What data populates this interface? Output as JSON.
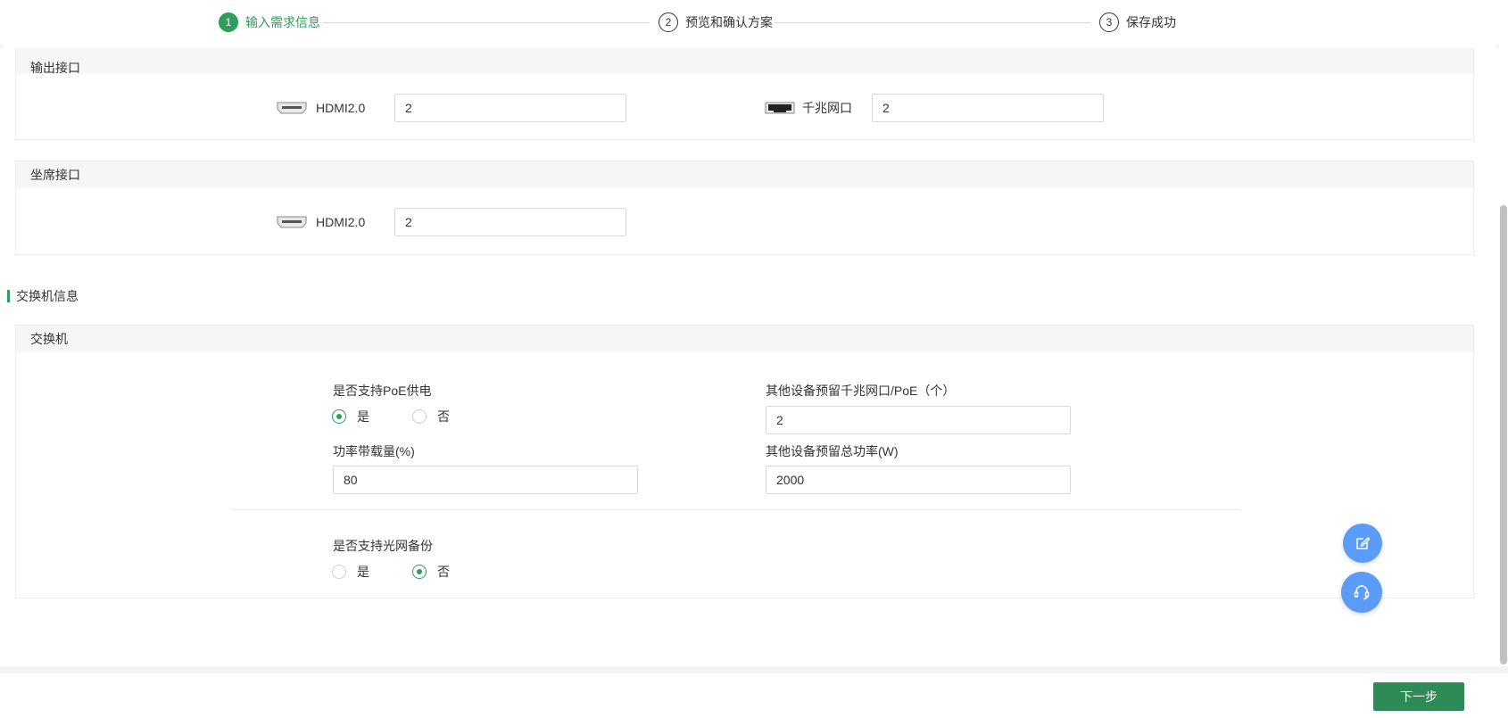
{
  "stepper": {
    "steps": [
      {
        "num": "1",
        "label": "输入需求信息"
      },
      {
        "num": "2",
        "label": "预览和确认方案"
      },
      {
        "num": "3",
        "label": "保存成功"
      }
    ]
  },
  "output_ports": {
    "title": "输出接口",
    "hdmi_label": "HDMI2.0",
    "hdmi_value": "2",
    "gigabit_label": "千兆网口",
    "gigabit_value": "2"
  },
  "seat_ports": {
    "title": "坐席接口",
    "hdmi_label": "HDMI2.0",
    "hdmi_value": "2"
  },
  "switch_section": {
    "title": "交换机信息",
    "card_title": "交换机",
    "poe_label": "是否支持PoE供电",
    "poe_options": [
      "是",
      "否"
    ],
    "poe_selected": "是",
    "reserved_ports_label": "其他设备预留千兆网口/PoE（个）",
    "reserved_ports_value": "2",
    "power_load_label": "功率带载量(%)",
    "power_load_value": "80",
    "reserved_power_label": "其他设备预留总功率(W)",
    "reserved_power_value": "2000",
    "fiber_backup_label": "是否支持光网备份",
    "fiber_options": [
      "是",
      "否"
    ],
    "fiber_selected": "否"
  },
  "footer": {
    "next_label": "下一步"
  },
  "colors": {
    "accent": "#2e9e5b",
    "fab": "#5b9cf8"
  }
}
